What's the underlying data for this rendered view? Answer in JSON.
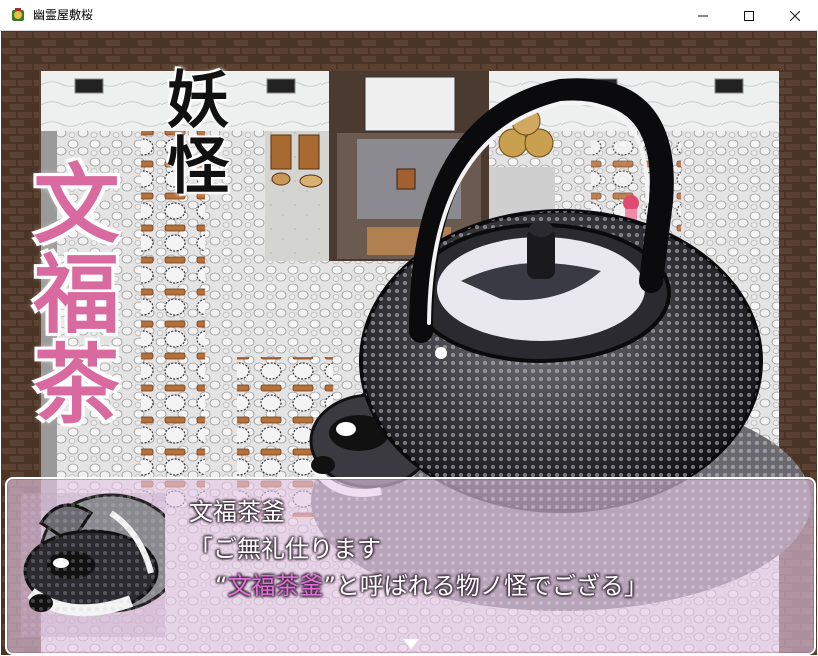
{
  "window": {
    "title": "幽霊屋敷桜",
    "icon": "game-app-icon",
    "minimize_icon": "minimize-icon",
    "maximize_icon": "maximize-icon",
    "close_icon": "close-icon"
  },
  "scene": {
    "title_small": "妖怪",
    "title_large": "文福茶",
    "colors": {
      "title_black": "#111111",
      "title_pink": "#d86aa0",
      "wood": "#5a4030",
      "floor": "#dcdcdc",
      "snow": "#f4f4f4"
    }
  },
  "message": {
    "speaker": "文福茶釜",
    "line1": "「ご無礼仕ります",
    "line2_open": "“",
    "line2_highlight": "文福茶釜",
    "line2_rest": "”と呼ばれる物ノ怪でござる」",
    "highlight_color": "#e070d8",
    "face_icon": "tanuki-face-icon",
    "pause_icon": "pause-arrow-icon"
  }
}
